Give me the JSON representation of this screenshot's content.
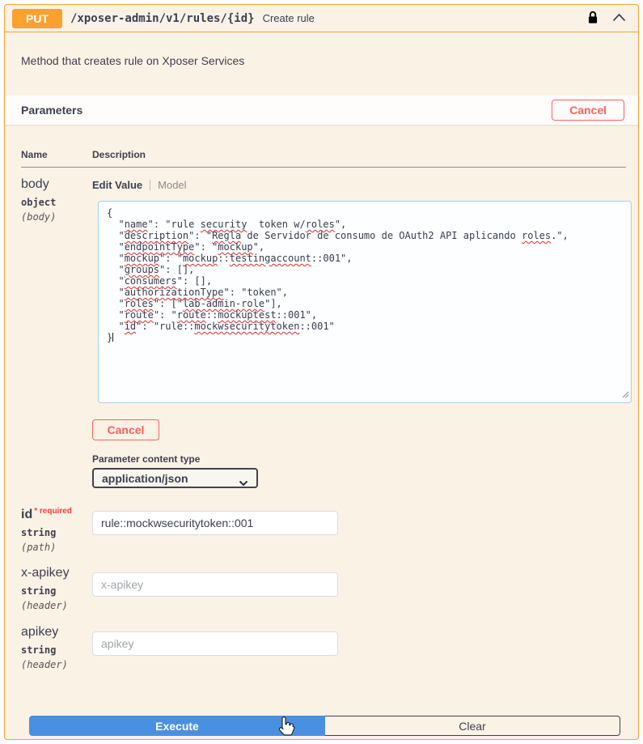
{
  "endpoint": {
    "method": "PUT",
    "path": "/xposer-admin/v1/rules/{id}",
    "summary": "Create rule",
    "description": "Method that creates rule on Xposer Services"
  },
  "parameters_section": {
    "title": "Parameters",
    "cancel_label": "Cancel",
    "columns": {
      "name": "Name",
      "description": "Description"
    }
  },
  "body_param": {
    "name": "body",
    "type": "object",
    "location": "(body)",
    "tabs": {
      "edit_value": "Edit Value",
      "model": "Model"
    },
    "value": "{\n  \"name\": \"rule security  token w/roles\",\n  \"description\": \"Regla de Servidor de consumo de OAuth2 API aplicando roles.\",\n  \"endpointType\": \"mockup\",\n  \"mockup\": \"mockup::testingaccount::001\",\n  \"groups\": [],\n  \"consumers\": [],\n  \"authorizationType\": \"token\",\n  \"roles\": [\"lab-admin-role\"],\n  \"route\": \"route::mockuptest::001\",\n  \"id\": \"rule::mockwsecuritytoken::001\"\n}",
    "misspelled_words": [
      "authorizationType",
      "mockwsecuritytoken",
      "lab-admin-role",
      "testingaccount",
      "endpointType",
      "description",
      "mockuptest",
      "consumers",
      "security",
      "groups",
      "mockup",
      "Regla",
      "roles",
      "route",
      "name",
      "id"
    ],
    "cancel_label": "Cancel",
    "content_type_label": "Parameter content type",
    "content_type_value": "application/json"
  },
  "id_param": {
    "name": "id",
    "required_label": "* required",
    "type": "string",
    "location": "(path)",
    "value": "rule::mockwsecuritytoken::001"
  },
  "x_apikey_param": {
    "name": "x-apikey",
    "type": "string",
    "location": "(header)",
    "placeholder": "x-apikey"
  },
  "apikey_param": {
    "name": "apikey",
    "type": "string",
    "location": "(header)",
    "placeholder": "apikey"
  },
  "actions": {
    "execute_label": "Execute",
    "clear_label": "Clear"
  },
  "colors": {
    "method_put": "#fca130",
    "block_background": "#fbf2e6",
    "cancel_red": "#ff6060",
    "execute_blue": "#4990e2",
    "text": "#3b4151",
    "spellcheck_squiggle": "#e02b2b"
  },
  "icons": {
    "lock": "lock-icon",
    "collapse": "chevron-up-icon",
    "select_caret": "chevron-down-icon",
    "cursor": "hand-pointer-cursor"
  }
}
